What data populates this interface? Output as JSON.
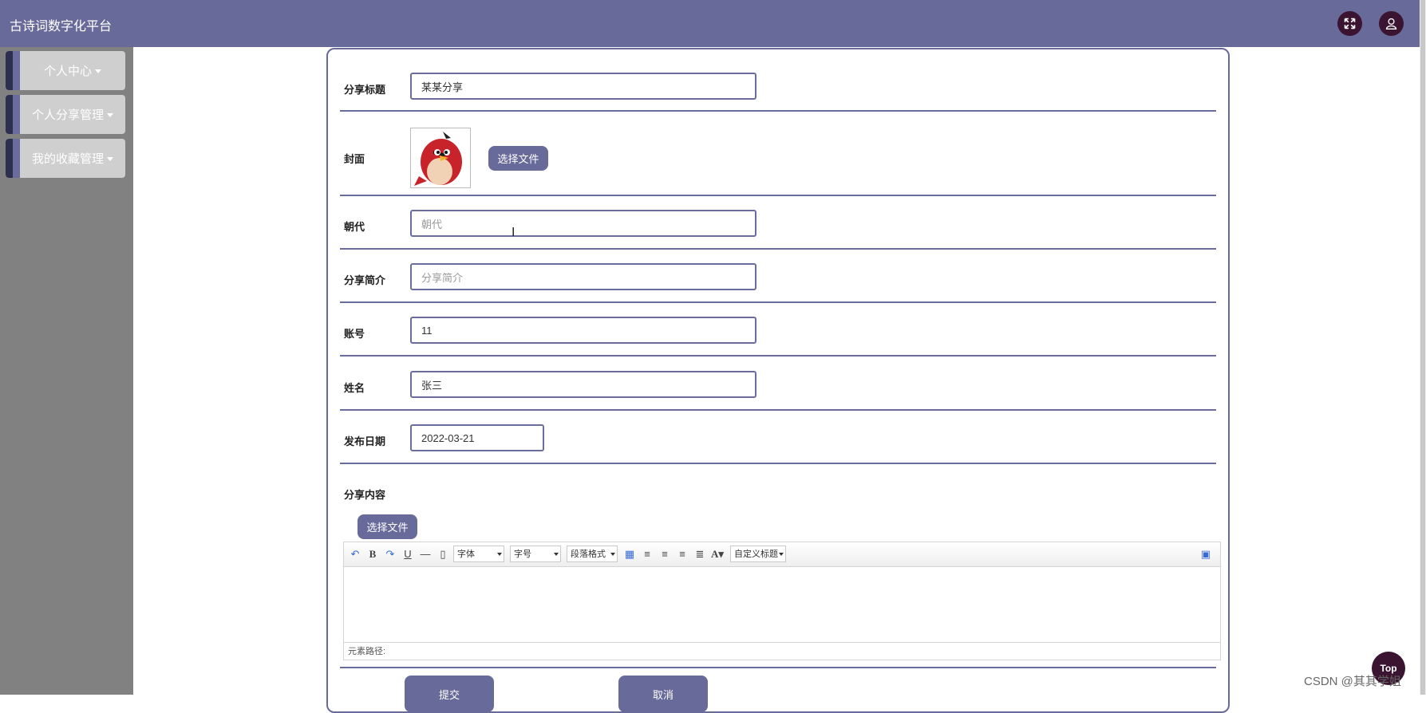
{
  "app": {
    "title": "古诗词数字化平台"
  },
  "header": {
    "fullscreen_icon": "expand-arrows-icon",
    "user_icon": "user-icon"
  },
  "sidebar": {
    "items": [
      {
        "label": "个人中心"
      },
      {
        "label": "个人分享管理"
      },
      {
        "label": "我的收藏管理"
      }
    ]
  },
  "form": {
    "title": {
      "label": "分享标题",
      "value": "某某分享"
    },
    "cover": {
      "label": "封面",
      "button": "选择文件",
      "image": "red-bird-image"
    },
    "dynasty": {
      "label": "朝代",
      "placeholder": "朝代"
    },
    "intro": {
      "label": "分享简介",
      "placeholder": "分享简介"
    },
    "account": {
      "label": "账号",
      "value": "11"
    },
    "name": {
      "label": "姓名",
      "value": "张三"
    },
    "date": {
      "label": "发布日期",
      "value": "2022-03-21"
    },
    "content": {
      "label": "分享内容",
      "button": "选择文件",
      "toolbar": {
        "font_select": "字体",
        "size_select": "字号",
        "paragraph_select": "段落格式",
        "custom_select": "自定义标题"
      },
      "status": "元素路径:"
    },
    "submit": "提交",
    "cancel": "取消"
  },
  "top_button": "Top",
  "watermark": "CSDN @其其学姐",
  "colors": {
    "primary": "#686a9a",
    "dark": "#3a1431",
    "sidebar": "#818181"
  }
}
